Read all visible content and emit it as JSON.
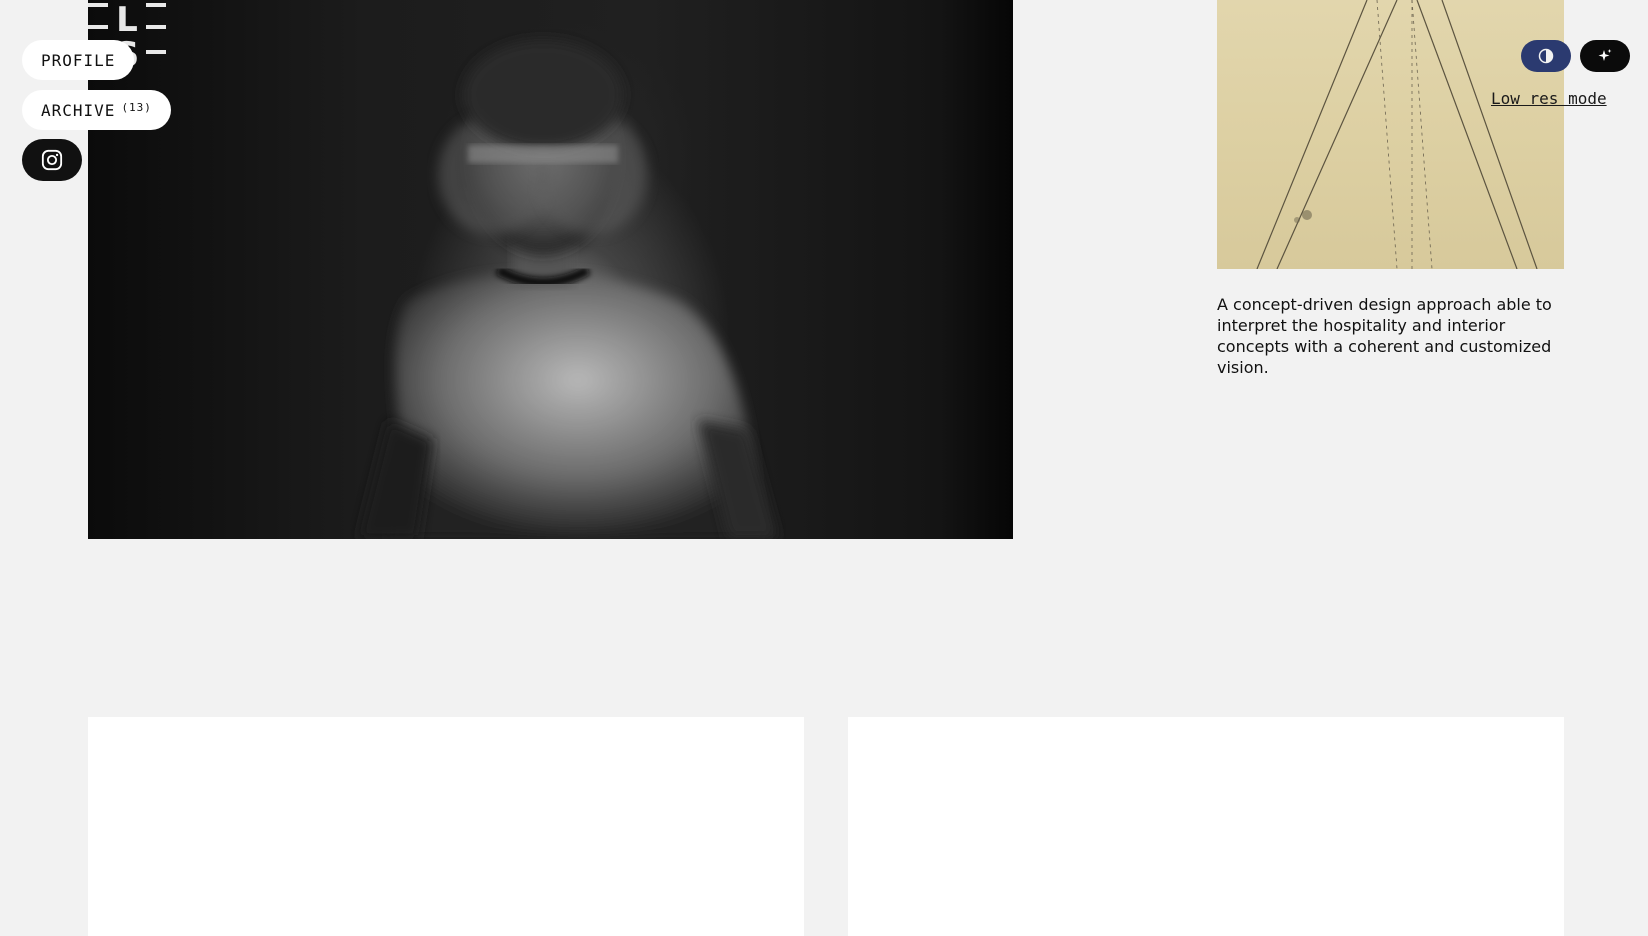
{
  "nav": {
    "profile_label": "PROFILE",
    "archive_label": "ARCHIVE",
    "archive_count": "(13)",
    "instagram_icon": "instagram-icon"
  },
  "hero": {
    "image": "blurred portrait of a boy in a white t-shirt",
    "logo_letters": [
      "L",
      "S"
    ]
  },
  "sidebar": {
    "description": "A concept-driven design approach able to interpret the hospitality and interior concepts with a coherent and customized vision."
  },
  "controls": {
    "contrast_icon": "contrast-icon",
    "sparkle_icon": "sparkle-icon",
    "low_res_label": "Low res mode",
    "contrast_color": "#2b3a70",
    "dark_color": "#0b0b0b"
  }
}
